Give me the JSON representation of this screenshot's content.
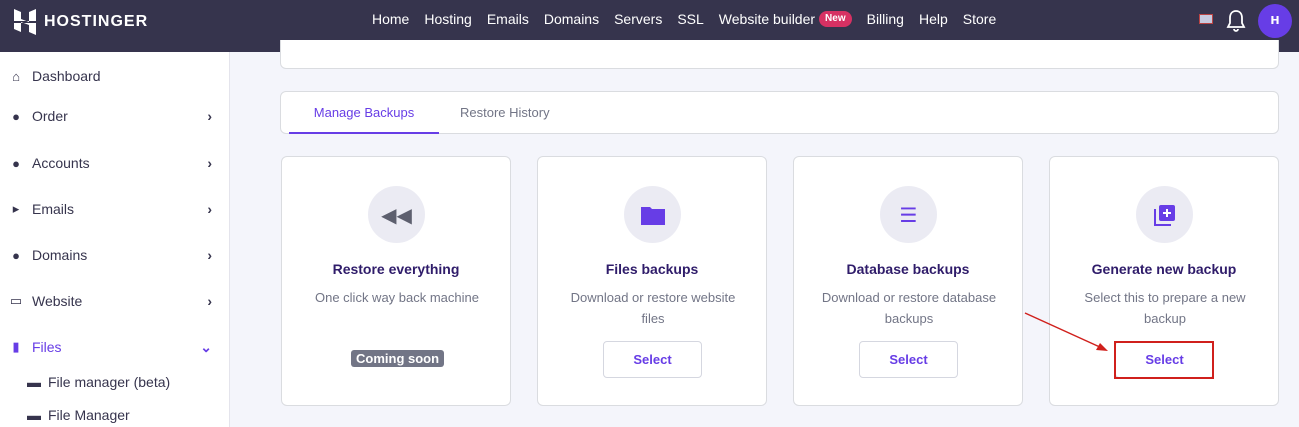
{
  "header": {
    "brand": "HOSTINGER",
    "nav": [
      "Home",
      "Hosting",
      "Emails",
      "Domains",
      "Servers",
      "SSL",
      "Website builder",
      "Billing",
      "Help",
      "Store"
    ],
    "new_badge": "New",
    "avatar": "H"
  },
  "sidebar": {
    "items": [
      {
        "label": "Dashboard",
        "icon": "home-icon"
      },
      {
        "label": "Order",
        "icon": "info-icon"
      },
      {
        "label": "Accounts",
        "icon": "info-icon"
      },
      {
        "label": "Emails",
        "icon": "email-icon"
      },
      {
        "label": "Domains",
        "icon": "globe-icon"
      },
      {
        "label": "Website",
        "icon": "monitor-icon"
      },
      {
        "label": "Files",
        "icon": "file-icon"
      }
    ],
    "sub_items": [
      "File manager (beta)",
      "File Manager"
    ]
  },
  "tabs": [
    "Manage Backups",
    "Restore History"
  ],
  "options": [
    {
      "title": "Restore everything",
      "desc": "One click way back machine",
      "badge": "Coming soon"
    },
    {
      "title": "Files backups",
      "desc": "Download or restore website files",
      "button": "Select"
    },
    {
      "title": "Database backups",
      "desc": "Download or restore database backups",
      "button": "Select"
    },
    {
      "title": "Generate new backup",
      "desc": "Select this to prepare a new backup",
      "button": "Select"
    }
  ],
  "colors": {
    "accent": "#673de6",
    "header": "#36344d",
    "highlight": "#d0201c"
  }
}
